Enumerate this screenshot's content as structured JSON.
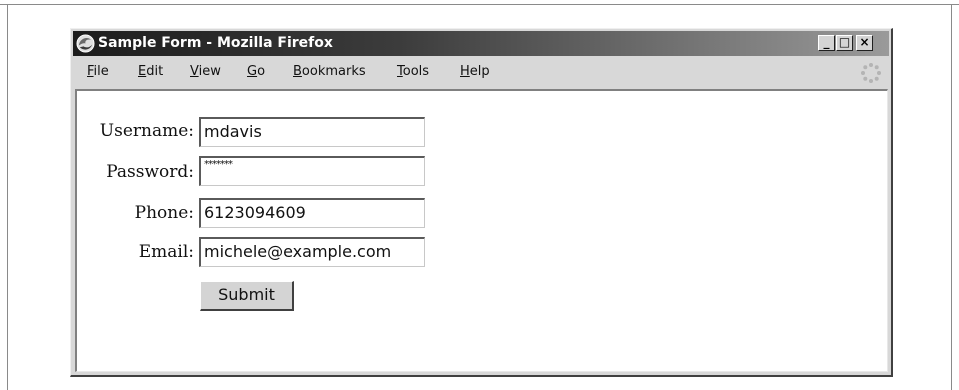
{
  "window": {
    "title": "Sample Form - Mozilla Firefox",
    "controls": {
      "minimize": "_",
      "maximize": "□",
      "close": "×"
    }
  },
  "menu": {
    "items": [
      {
        "first": "F",
        "rest": "ile"
      },
      {
        "first": "E",
        "rest": "dit"
      },
      {
        "first": "V",
        "rest": "iew"
      },
      {
        "first": "G",
        "rest": "o"
      },
      {
        "first": "B",
        "rest": "ookmarks"
      },
      {
        "first": "T",
        "rest": "ools"
      },
      {
        "first": "H",
        "rest": "elp"
      }
    ]
  },
  "form": {
    "username": {
      "label": "Username:",
      "value": "mdavis"
    },
    "password": {
      "label": "Password:",
      "value": "*******"
    },
    "phone": {
      "label": "Phone:",
      "value": "6123094609"
    },
    "email": {
      "label": "Email:",
      "value": "michele@example.com"
    },
    "submit_label": "Submit"
  },
  "icons": {
    "app": "firefox-icon",
    "activity": "throbber-icon"
  }
}
